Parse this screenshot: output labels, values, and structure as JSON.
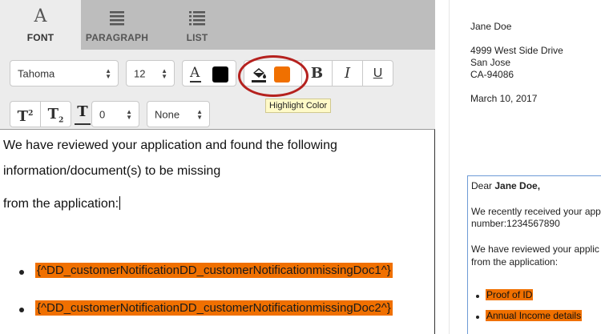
{
  "tabs": {
    "font": "FONT",
    "paragraph": "PARAGRAPH",
    "list": "LIST",
    "font_glyph": "A"
  },
  "toolbar": {
    "font_family": "Tahoma",
    "font_size": "12",
    "text_color_glyph": "A",
    "text_color": "#000000",
    "highlight_color": "#f07000",
    "bold": "B",
    "italic": "I",
    "underline": "U",
    "superscript": "T",
    "superscript_mark": "2",
    "subscript": "T",
    "subscript_mark": "2",
    "letter_spacing_glyph": "T",
    "spacing_value": "0",
    "case_value": "None",
    "tooltip": "Highlight Color"
  },
  "editor": {
    "paragraph1": "We have reviewed your application and found the following",
    "paragraph2": "information/document(s) to be missing",
    "paragraph3": "from the application:",
    "bullets": [
      "{^DD_customerNotificationDD_customerNotificationmissingDoc1^}",
      "{^DD_customerNotificationDD_customerNotificationmissingDoc2^}"
    ]
  },
  "preview": {
    "name": "Jane Doe",
    "address1": "4999 West Side Drive",
    "address2": "San Jose",
    "address3": "CA-94086",
    "date": "March 10, 2017",
    "dear_prefix": "Dear ",
    "dear_name": "Jane Doe,",
    "received_line1": "We recently received your app",
    "received_line2": "number:1234567890",
    "reviewed_line1": "We have reviewed your applic",
    "reviewed_line2": "from the application:",
    "bullets": [
      "Proof of ID",
      "Annual Income details"
    ]
  },
  "colors": {
    "highlight": "#f07000",
    "ring": "#b5211e",
    "preview_border": "#6d9ad6"
  }
}
